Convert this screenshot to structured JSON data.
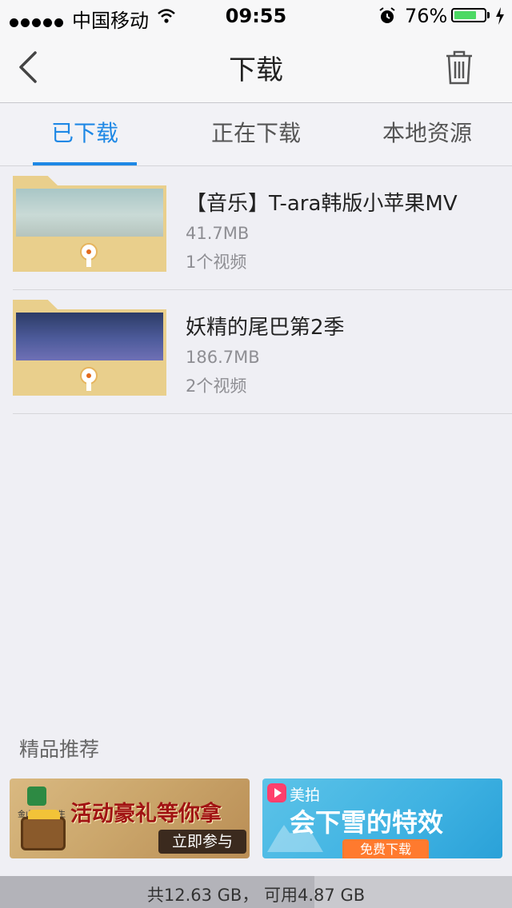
{
  "status_bar": {
    "carrier": "中国移动",
    "time": "09:55",
    "battery_percent": "76%",
    "battery_level": 0.76,
    "icons": [
      "signal-icon",
      "wifi-icon",
      "alarm-icon",
      "battery-icon",
      "charging-icon"
    ]
  },
  "nav": {
    "title": "下载",
    "back_icon": "chevron-left-icon",
    "trash_icon": "trash-icon"
  },
  "tabs": [
    {
      "label": "已下载",
      "active": true
    },
    {
      "label": "正在下载",
      "active": false
    },
    {
      "label": "本地资源",
      "active": false
    }
  ],
  "downloads": [
    {
      "name": "【音乐】T-ara韩版小苹果MV",
      "size": "41.7MB",
      "count": "1个视频"
    },
    {
      "name": "妖精的尾巴第2季",
      "size": "186.7MB",
      "count": "2个视频"
    }
  ],
  "recommend": {
    "title": "精品推荐",
    "ads": [
      {
        "app_name": "金山电池医生",
        "headline": "活动豪礼等你拿",
        "cta": "立即参与"
      },
      {
        "brand": "美拍",
        "headline": "会下雪的特效",
        "cta": "免费下载"
      }
    ]
  },
  "storage": {
    "text": "共12.63 GB， 可用4.87 GB",
    "used_fraction": 0.614
  },
  "colors": {
    "accent": "#1e88e5",
    "folder": "#e9cf8c",
    "background": "#efeff4"
  }
}
